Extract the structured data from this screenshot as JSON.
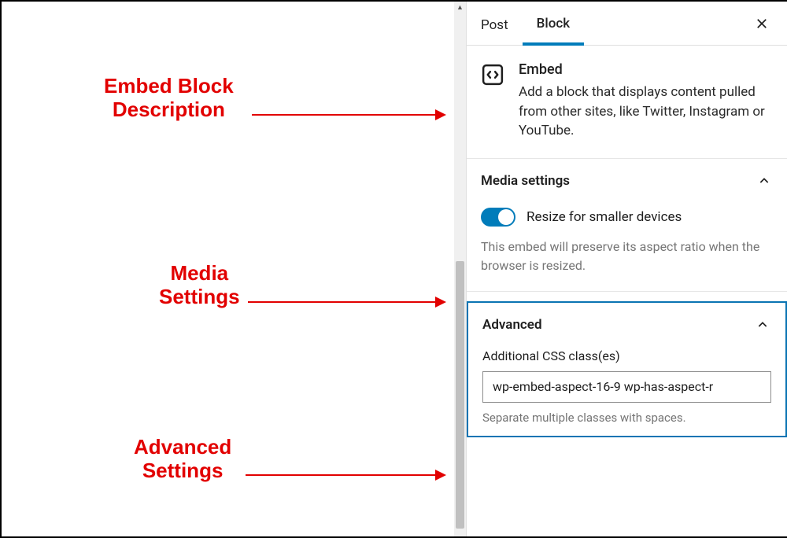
{
  "tabs": {
    "post": "Post",
    "block": "Block"
  },
  "block_desc": {
    "title": "Embed",
    "subtitle": "Add a block that displays content pulled from other sites, like Twitter, Instagram or YouTube."
  },
  "media_settings": {
    "title": "Media settings",
    "toggle_label": "Resize for smaller devices",
    "help_text": "This embed will preserve its aspect ratio when the browser is resized."
  },
  "advanced": {
    "title": "Advanced",
    "css_label": "Additional CSS class(es)",
    "css_value": "wp-embed-aspect-16-9 wp-has-aspect-r",
    "css_help": "Separate multiple classes with spaces."
  },
  "annotations": {
    "desc_l1": "Embed Block",
    "desc_l2": "Description",
    "media_l1": "Media",
    "media_l2": "Settings",
    "adv_l1": "Advanced",
    "adv_l2": "Settings"
  }
}
